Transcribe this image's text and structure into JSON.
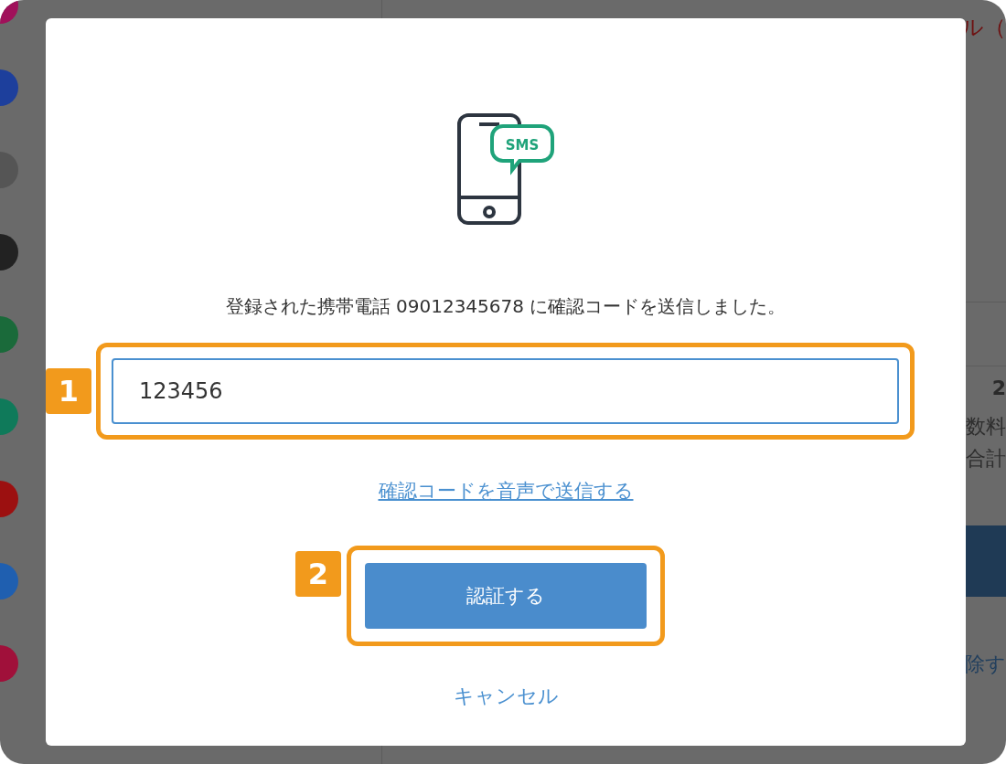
{
  "background": {
    "sidebar": {
      "items": [
        {
          "color": "#a0105a"
        },
        {
          "color": "#1d3f9c"
        },
        {
          "color": "#555555"
        },
        {
          "color": "#222222"
        },
        {
          "color": "#1a6a3a"
        },
        {
          "color": "#0f7a5a"
        },
        {
          "color": "#9c1010"
        },
        {
          "color": "#1f5fb0"
        },
        {
          "color": "#a0103a"
        }
      ]
    },
    "content": {
      "notice": "ル（",
      "amount": "2",
      "fee_label": "数料",
      "total_label": "合計",
      "remove_link": "除す"
    }
  },
  "modal": {
    "icon_text": "SMS",
    "message": "登録された携帯電話 09012345678 に確認コードを送信しました。",
    "code_field": {
      "value": "123456",
      "badge": "1"
    },
    "voice_link": "確認コードを音声で送信する",
    "submit": {
      "label": "認証する",
      "badge": "2"
    },
    "cancel": "キャンセル"
  }
}
